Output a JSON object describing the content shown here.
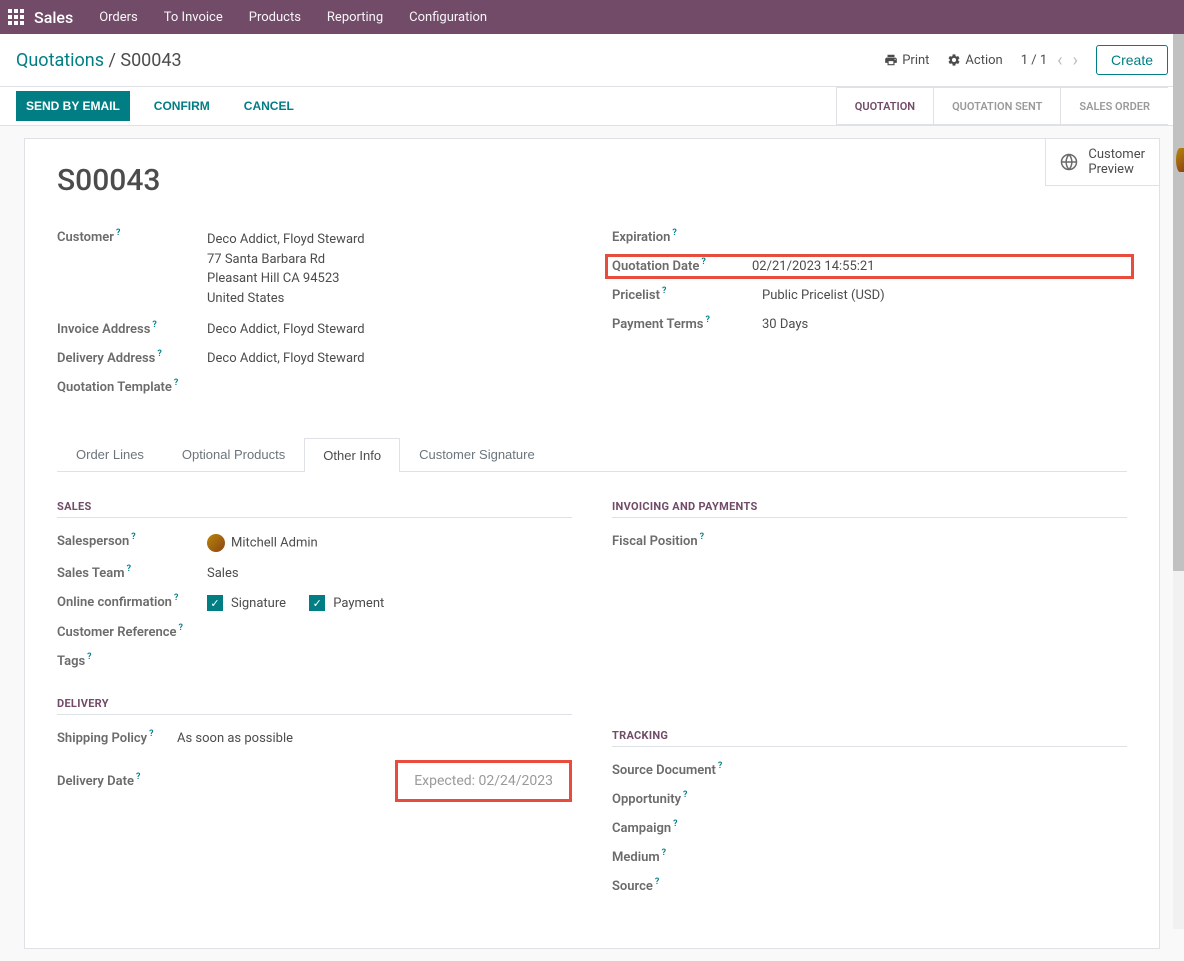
{
  "topbar": {
    "brand": "Sales",
    "menu": [
      "Orders",
      "To Invoice",
      "Products",
      "Reporting",
      "Configuration"
    ]
  },
  "breadcrumb": {
    "root": "Quotations",
    "sep": " / ",
    "current": "S00043"
  },
  "cp": {
    "print": "Print",
    "action": "Action",
    "pager": "1 / 1",
    "create": "Create"
  },
  "status_buttons": {
    "send": "SEND BY EMAIL",
    "confirm": "CONFIRM",
    "cancel": "CANCEL"
  },
  "status_steps": [
    "QUOTATION",
    "QUOTATION SENT",
    "SALES ORDER"
  ],
  "button_box": {
    "line1": "Customer",
    "line2": "Preview"
  },
  "record": {
    "name": "S00043",
    "labels": {
      "customer": "Customer",
      "invoice_addr": "Invoice Address",
      "delivery_addr": "Delivery Address",
      "quotation_template": "Quotation Template",
      "expiration": "Expiration",
      "quotation_date": "Quotation Date",
      "pricelist": "Pricelist",
      "payment_terms": "Payment Terms"
    },
    "customer_name": "Deco Addict, Floyd Steward",
    "address": {
      "street": "77 Santa Barbara Rd",
      "city": "Pleasant Hill CA 94523",
      "country": "United States"
    },
    "invoice_address": "Deco Addict, Floyd Steward",
    "delivery_address": "Deco Addict, Floyd Steward",
    "quotation_date": "02/21/2023 14:55:21",
    "pricelist": "Public Pricelist (USD)",
    "payment_terms": "30 Days"
  },
  "tabs": [
    "Order Lines",
    "Optional Products",
    "Other Info",
    "Customer Signature"
  ],
  "sections": {
    "sales": {
      "heading": "SALES",
      "labels": {
        "salesperson": "Salesperson",
        "sales_team": "Sales Team",
        "online_conf": "Online confirmation",
        "cust_ref": "Customer Reference",
        "tags": "Tags"
      },
      "salesperson": "Mitchell Admin",
      "sales_team": "Sales",
      "signature_label": "Signature",
      "payment_label": "Payment"
    },
    "invoicing": {
      "heading": "INVOICING AND PAYMENTS",
      "labels": {
        "fiscal_position": "Fiscal Position"
      }
    },
    "delivery": {
      "heading": "DELIVERY",
      "labels": {
        "shipping_policy": "Shipping Policy",
        "delivery_date": "Delivery Date"
      },
      "shipping_policy": "As soon as possible",
      "expected": "Expected: 02/24/2023"
    },
    "tracking": {
      "heading": "TRACKING",
      "labels": {
        "source_document": "Source Document",
        "opportunity": "Opportunity",
        "campaign": "Campaign",
        "medium": "Medium",
        "source": "Source"
      }
    }
  }
}
